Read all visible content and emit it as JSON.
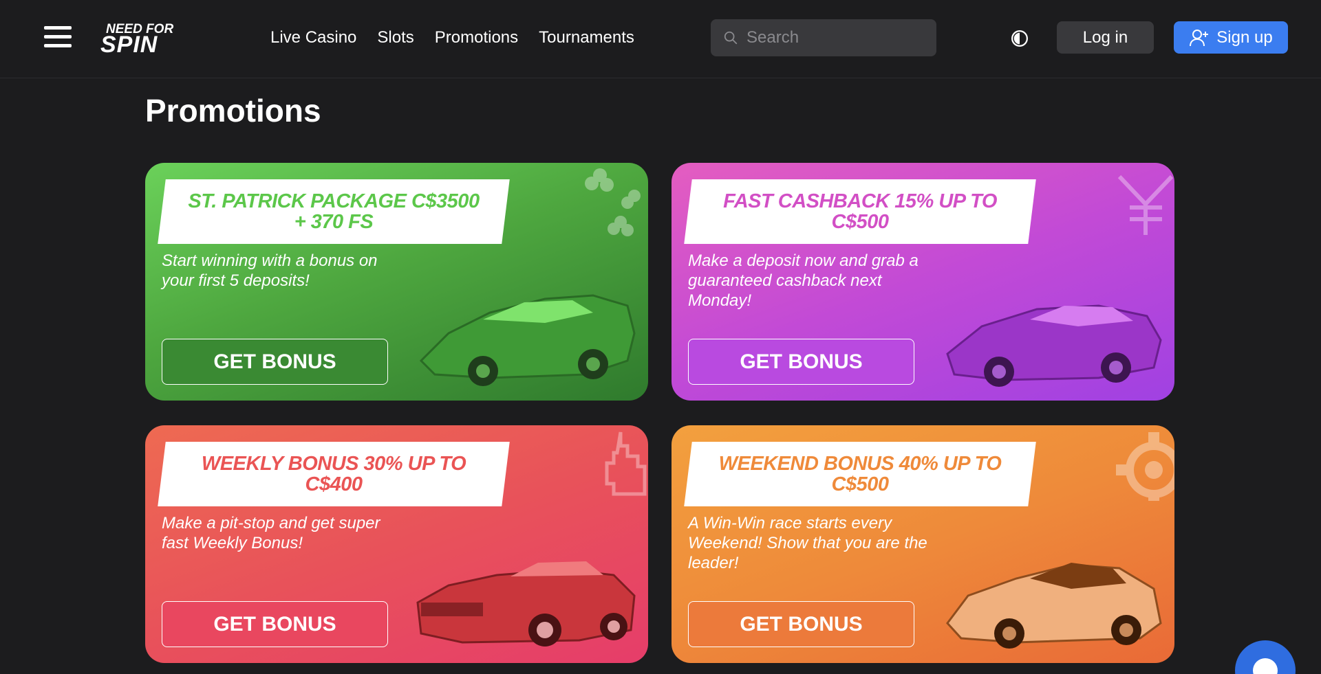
{
  "header": {
    "logo_alt": "NEED FOR SPIN",
    "nav": [
      "Live Casino",
      "Slots",
      "Promotions",
      "Tournaments"
    ],
    "search_placeholder": "Search",
    "login_label": "Log in",
    "signup_label": "Sign up",
    "accent_color": "#3b7df0"
  },
  "page": {
    "title": "Promotions"
  },
  "promos": [
    {
      "title": "ST. PATRICK PACKAGE C$3500 + 370 FS",
      "description": "Start winning with a bonus on your first 5 deposits!",
      "button": "GET BONUS",
      "color": "#5cc74a",
      "icon": "clover-icon"
    },
    {
      "title": "FAST CASHBACK 15% UP TO C$500",
      "description": "Make a deposit now and grab a guaranteed cashback next Monday!",
      "button": "GET BONUS",
      "color": "#c24ad6",
      "icon": "yen-icon"
    },
    {
      "title": "WEEKLY BONUS 30% UP TO C$400",
      "description": "Make a pit-stop and get super fast Weekly Bonus!",
      "button": "GET BONUS",
      "color": "#e8525a",
      "icon": "pixel-drop-icon"
    },
    {
      "title": "WEEKEND BONUS 40% UP TO C$500",
      "description": "A Win-Win race starts every Weekend! Show that you are the leader!",
      "button": "GET BONUS",
      "color": "#ee8a3a",
      "icon": "gear-icon"
    }
  ]
}
